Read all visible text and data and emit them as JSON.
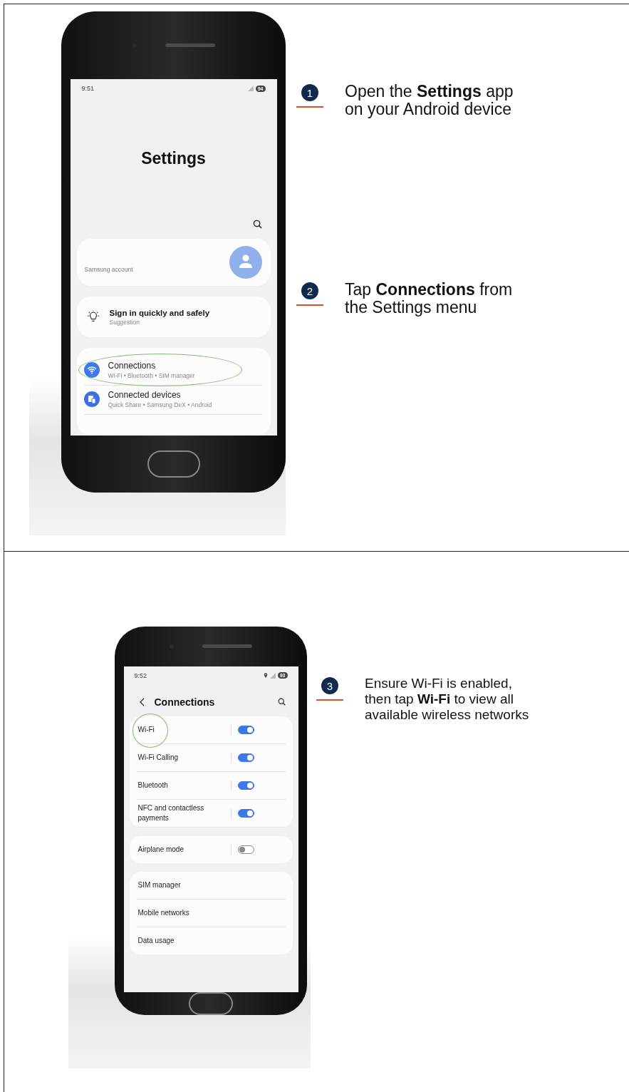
{
  "panels": [
    {
      "kind": "settings",
      "phone": {
        "time": "9:51",
        "battery": "94",
        "title": "Settings",
        "account": {
          "label": "Samsung account"
        },
        "suggestion": {
          "title": "Sign in quickly and safely",
          "subtitle": "Suggestion"
        },
        "items": [
          {
            "kind": "wifi",
            "title": "Connections",
            "subtitle": "Wi-Fi  •  Bluetooth  •  SIM manager",
            "highlighted": true
          },
          {
            "kind": "devices",
            "title": "Connected devices",
            "subtitle": "Quick Share  •  Samsung DeX  •  Android",
            "highlighted": false
          }
        ]
      },
      "steps": [
        {
          "number": "1",
          "text": "Open the **Settings** app on your Android device"
        },
        {
          "number": "2",
          "text": "Tap **Connections** from the Settings menu"
        }
      ]
    },
    {
      "kind": "connections",
      "phone": {
        "time": "9:52",
        "battery": "93",
        "location": true,
        "title": "Connections",
        "groups": [
          {
            "rows": [
              {
                "label": "Wi-Fi",
                "on": true,
                "highlighted": true
              },
              {
                "label": "Wi-Fi Calling",
                "on": true,
                "highlighted": false
              },
              {
                "label": "Bluetooth",
                "on": true,
                "highlighted": false
              },
              {
                "label": "NFC and contactless payments",
                "on": true,
                "highlighted": false
              }
            ]
          },
          {
            "rows": [
              {
                "label": "Airplane mode",
                "on": false,
                "highlighted": false
              }
            ]
          },
          {
            "rows": [
              {
                "label": "SIM manager"
              },
              {
                "label": "Mobile networks"
              },
              {
                "label": "Data usage"
              }
            ]
          }
        ]
      },
      "steps": [
        {
          "number": "3",
          "text": "Ensure Wi-Fi is enabled, then tap **Wi-Fi** to view all available wireless networks"
        }
      ]
    }
  ]
}
